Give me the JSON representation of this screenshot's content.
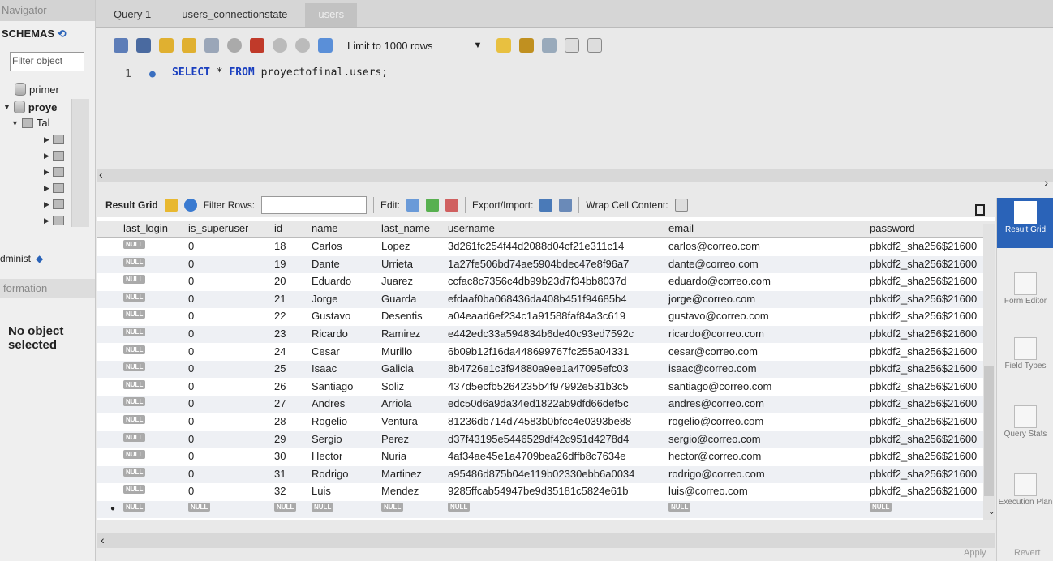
{
  "navigator": {
    "header": "Navigator",
    "schemas_label": "SCHEMAS",
    "filter_placeholder": "Filter object",
    "tree": [
      "primer",
      "proye",
      "Tal"
    ],
    "admin_label": "dminist",
    "info_label": "formation",
    "no_object": "No object selected"
  },
  "tabs": [
    {
      "label": "Query 1",
      "active": false
    },
    {
      "label": "users_connectionstate",
      "active": false
    },
    {
      "label": "users",
      "active": true
    }
  ],
  "toolbar": {
    "limit_label": "Limit to 1000 rows"
  },
  "editor": {
    "line_number": "1",
    "sql_keyword1": "SELECT",
    "sql_star": "*",
    "sql_keyword2": "FROM",
    "sql_rest": "proyectofinal.users;"
  },
  "result_bar": {
    "result_grid": "Result Grid",
    "filter_rows": "Filter Rows:",
    "edit": "Edit:",
    "export_import": "Export/Import:",
    "wrap": "Wrap Cell Content:"
  },
  "grid": {
    "columns": [
      "last_login",
      "is_superuser",
      "id",
      "name",
      "last_name",
      "username",
      "email",
      "password"
    ],
    "null_text": "NULL",
    "rows": [
      [
        "NULL",
        "0",
        "18",
        "Carlos",
        "Lopez",
        "3d261fc254f44d2088d04cf21e311c14",
        "carlos@correo.com",
        "pbkdf2_sha256$21600"
      ],
      [
        "NULL",
        "0",
        "19",
        "Dante",
        "Urrieta",
        "1a27fe506bd74ae5904bdec47e8f96a7",
        "dante@correo.com",
        "pbkdf2_sha256$21600"
      ],
      [
        "NULL",
        "0",
        "20",
        "Eduardo",
        "Juarez",
        "ccfac8c7356c4db99b23d7f34bb8037d",
        "eduardo@correo.com",
        "pbkdf2_sha256$21600"
      ],
      [
        "NULL",
        "0",
        "21",
        "Jorge",
        "Guarda",
        "efdaaf0ba068436da408b451f94685b4",
        "jorge@correo.com",
        "pbkdf2_sha256$21600"
      ],
      [
        "NULL",
        "0",
        "22",
        "Gustavo",
        "Desentis",
        "a04eaad6ef234c1a91588faf84a3c619",
        "gustavo@correo.com",
        "pbkdf2_sha256$21600"
      ],
      [
        "NULL",
        "0",
        "23",
        "Ricardo",
        "Ramirez",
        "e442edc33a594834b6de40c93ed7592c",
        "ricardo@correo.com",
        "pbkdf2_sha256$21600"
      ],
      [
        "NULL",
        "0",
        "24",
        "Cesar",
        "Murillo",
        "6b09b12f16da448699767fc255a04331",
        "cesar@correo.com",
        "pbkdf2_sha256$21600"
      ],
      [
        "NULL",
        "0",
        "25",
        "Isaac",
        "Galicia",
        "8b4726e1c3f94880a9ee1a47095efc03",
        "isaac@correo.com",
        "pbkdf2_sha256$21600"
      ],
      [
        "NULL",
        "0",
        "26",
        "Santiago",
        "Soliz",
        "437d5ecfb5264235b4f97992e531b3c5",
        "santiago@correo.com",
        "pbkdf2_sha256$21600"
      ],
      [
        "NULL",
        "0",
        "27",
        "Andres",
        "Arriola",
        "edc50d6a9da34ed1822ab9dfd66def5c",
        "andres@correo.com",
        "pbkdf2_sha256$21600"
      ],
      [
        "NULL",
        "0",
        "28",
        "Rogelio",
        "Ventura",
        "81236db714d74583b0bfcc4e0393be88",
        "rogelio@correo.com",
        "pbkdf2_sha256$21600"
      ],
      [
        "NULL",
        "0",
        "29",
        "Sergio",
        "Perez",
        "d37f43195e5446529df42c951d4278d4",
        "sergio@correo.com",
        "pbkdf2_sha256$21600"
      ],
      [
        "NULL",
        "0",
        "30",
        "Hector",
        "Nuria",
        "4af34ae45e1a4709bea26dffb8c7634e",
        "hector@correo.com",
        "pbkdf2_sha256$21600"
      ],
      [
        "NULL",
        "0",
        "31",
        "Rodrigo",
        "Martinez",
        "a95486d875b04e119b02330ebb6a0034",
        "rodrigo@correo.com",
        "pbkdf2_sha256$21600"
      ],
      [
        "NULL",
        "0",
        "32",
        "Luis",
        "Mendez",
        "9285ffcab54947be9d35181c5824e61b",
        "luis@correo.com",
        "pbkdf2_sha256$21600"
      ],
      [
        "NULL",
        "NULL",
        "NULL",
        "NULL",
        "NULL",
        "NULL",
        "NULL",
        "NULL"
      ]
    ]
  },
  "side_panel": {
    "result_grid": "Result Grid",
    "form_editor": "Form Editor",
    "field_types": "Field Types",
    "query_stats": "Query Stats",
    "execution_plan": "Execution Plan"
  },
  "footer": {
    "apply": "Apply",
    "revert": "Revert"
  },
  "colors": {
    "accent": "#2a63b8",
    "keyword": "#1a3fbf"
  }
}
